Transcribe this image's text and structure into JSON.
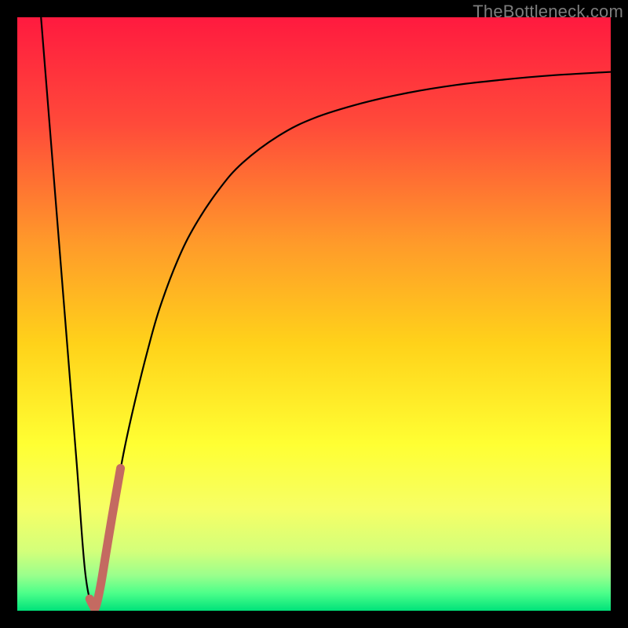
{
  "watermark": "TheBottleneck.com",
  "chart_data": {
    "type": "line",
    "title": "",
    "xlabel": "",
    "ylabel": "",
    "xlim": [
      0,
      100
    ],
    "ylim": [
      0,
      100
    ],
    "background": {
      "gradient_type": "vertical",
      "stops": [
        {
          "pos": 0.0,
          "color": "#ff1a3f"
        },
        {
          "pos": 0.18,
          "color": "#ff4a3a"
        },
        {
          "pos": 0.38,
          "color": "#ff9a2a"
        },
        {
          "pos": 0.55,
          "color": "#ffd21a"
        },
        {
          "pos": 0.72,
          "color": "#ffff33"
        },
        {
          "pos": 0.83,
          "color": "#f6ff66"
        },
        {
          "pos": 0.9,
          "color": "#d3ff7a"
        },
        {
          "pos": 0.94,
          "color": "#9bff8c"
        },
        {
          "pos": 0.97,
          "color": "#4dff8a"
        },
        {
          "pos": 1.0,
          "color": "#00e27a"
        }
      ]
    },
    "series": [
      {
        "name": "curve-main",
        "stroke": "#000000",
        "stroke_width": 2.2,
        "x": [
          4.0,
          6.0,
          8.0,
          10.0,
          11.5,
          13.0,
          14.0,
          15.0,
          16.0,
          18.0,
          20.0,
          22.0,
          24.0,
          27.0,
          30.0,
          34.0,
          38.0,
          44.0,
          50.0,
          58.0,
          66.0,
          74.0,
          82.0,
          90.0,
          100.0
        ],
        "y": [
          100.0,
          75.0,
          50.0,
          25.0,
          6.0,
          0.5,
          4.0,
          10.0,
          16.0,
          27.0,
          36.0,
          44.0,
          51.0,
          59.0,
          65.0,
          71.0,
          75.5,
          80.0,
          83.0,
          85.5,
          87.3,
          88.6,
          89.5,
          90.2,
          90.8
        ]
      },
      {
        "name": "highlight-segment",
        "stroke": "#c46a61",
        "stroke_width": 11,
        "linecap": "round",
        "x": [
          12.2,
          12.8,
          13.2,
          14.0,
          15.0,
          16.0,
          17.4
        ],
        "y": [
          2.0,
          0.8,
          0.6,
          4.0,
          10.0,
          16.0,
          24.0
        ]
      }
    ]
  }
}
